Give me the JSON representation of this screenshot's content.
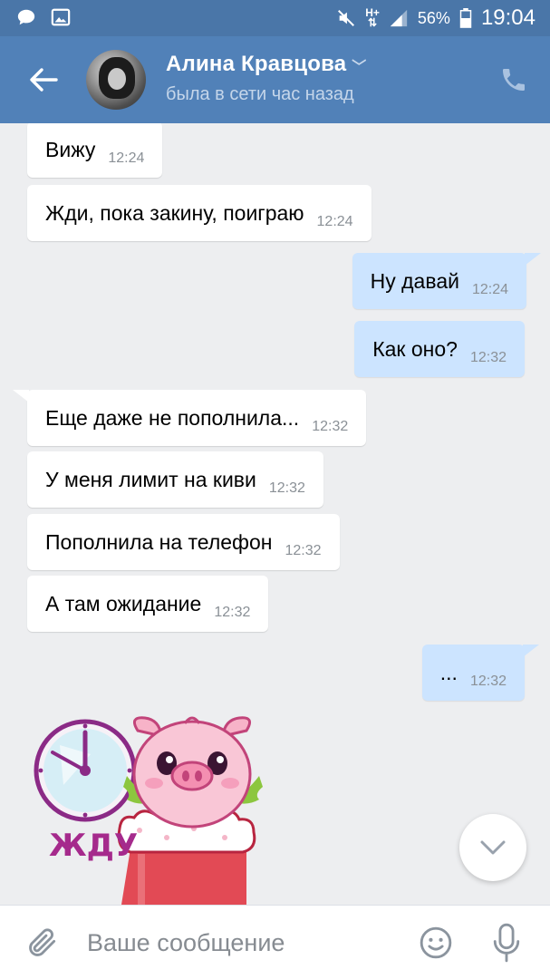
{
  "status_bar": {
    "network": "H+",
    "battery": "56%",
    "time": "19:04"
  },
  "header": {
    "name": "Алина Кравцова",
    "status": "была в сети час назад"
  },
  "messages": [
    {
      "dir": "in",
      "text": "Вижу",
      "time": "12:24"
    },
    {
      "dir": "in",
      "text": "Жди, пока закину, поиграю",
      "time": "12:24"
    },
    {
      "dir": "out",
      "text": "Ну давай",
      "time": "12:24"
    },
    {
      "dir": "out",
      "text": "Как оно?",
      "time": "12:32"
    },
    {
      "dir": "in",
      "text": "Еще даже не пополнила...",
      "time": "12:32"
    },
    {
      "dir": "in",
      "text": "У меня лимит на киви",
      "time": "12:32"
    },
    {
      "dir": "in",
      "text": "Пополнила на телефон",
      "time": "12:32"
    },
    {
      "dir": "in",
      "text": "А там ожидание",
      "time": "12:32"
    },
    {
      "dir": "out",
      "text": "...",
      "time": "12:32"
    }
  ],
  "sticker": {
    "caption": "ЖДУ"
  },
  "composer": {
    "placeholder": "Ваше сообщение"
  },
  "colors": {
    "header": "#5181b8",
    "status_bar": "#4a76a8",
    "chat_bg": "#edeef0",
    "incoming_bubble": "#ffffff",
    "outgoing_bubble": "#cce4ff"
  }
}
